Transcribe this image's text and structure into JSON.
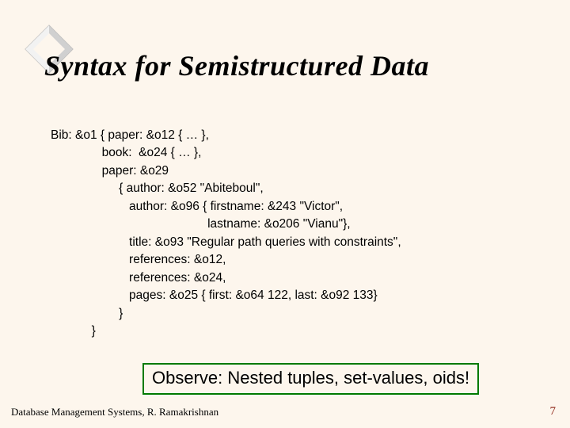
{
  "title": "Syntax for Semistructured Data",
  "code_lines": [
    "Bib: &o1 { paper: &o12 { … },",
    "               book:  &o24 { … },",
    "               paper: &o29",
    "                    { author: &o52 \"Abiteboul\",",
    "                       author: &o96 { firstname: &243 \"Victor\",",
    "                                              lastname: &o206 \"Vianu\"},",
    "                       title: &o93 \"Regular path queries with constraints\",",
    "                       references: &o12,",
    "                       references: &o24,",
    "                       pages: &o25 { first: &o64 122, last: &o92 133}",
    "                    }",
    "            }"
  ],
  "callout": "Observe: Nested tuples, set-values, oids!",
  "footer_left": "Database Management Systems, R. Ramakrishnan",
  "footer_right": "7"
}
